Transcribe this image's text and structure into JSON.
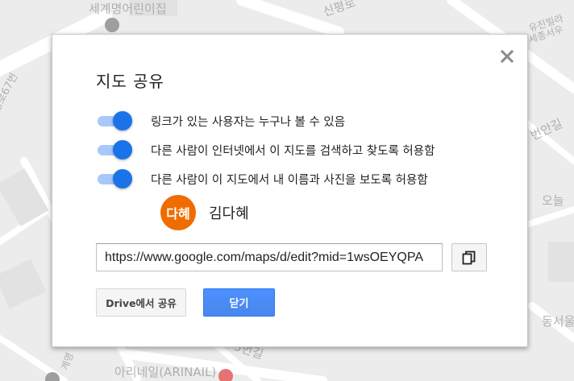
{
  "map": {
    "labels": [
      "세계명어린이집",
      "신평로",
      "유진빌라",
      "세종서우",
      "신평로67번",
      "번안길",
      "오늘",
      "동서울",
      "계명",
      "5번길",
      "아리네일(ARINAIL)"
    ]
  },
  "dialog": {
    "title": "지도 공유",
    "options": [
      {
        "label": "링크가 있는 사용자는 누구나 볼 수 있음",
        "enabled": true
      },
      {
        "label": "다른 사람이 인터넷에서 이 지도를 검색하고 찾도록 허용함",
        "enabled": true
      },
      {
        "label": "다른 사람이 이 지도에서 내 이름과 사진을 보도록 허용함",
        "enabled": true
      }
    ],
    "user": {
      "avatar_text": "다혜",
      "name": "김다혜"
    },
    "share_url": "https://www.google.com/maps/d/edit?mid=1wsOEYQPA",
    "drive_share_label": "Drive에서 공유",
    "close_label": "닫기"
  },
  "colors": {
    "toggle_on": "#1a73e8",
    "toggle_track": "#a8c7fa",
    "avatar": "#ef6c00",
    "primary_button": "#4d90fe"
  },
  "icons": {
    "close": "close-icon",
    "copy": "copy-icon"
  }
}
